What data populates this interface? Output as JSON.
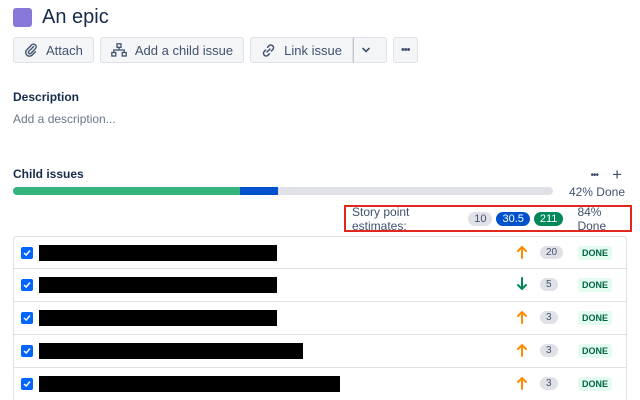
{
  "issue": {
    "title": "An epic",
    "type_color": "#8777d9"
  },
  "toolbar": {
    "attach_label": "Attach",
    "add_child_label": "Add a child issue",
    "link_label": "Link issue",
    "more_label": "•••"
  },
  "description": {
    "label": "Description",
    "placeholder": "Add a description..."
  },
  "child_issues": {
    "label": "Child issues",
    "more_label": "•••",
    "add_label": "+",
    "progress": {
      "done_fraction": 0.42,
      "in_progress_fraction": 0.07,
      "text": "42% Done"
    },
    "estimates": {
      "label": "Story point estimates:",
      "todo": "10",
      "in_progress": "30.5",
      "done": "211",
      "percent_text": "84% Done"
    },
    "rows": [
      {
        "priority": "up",
        "points": "20",
        "status": "DONE"
      },
      {
        "priority": "down",
        "points": "5",
        "status": "DONE"
      },
      {
        "priority": "up",
        "points": "3",
        "status": "DONE"
      },
      {
        "priority": "up",
        "points": "3",
        "status": "DONE"
      },
      {
        "priority": "up",
        "points": "3",
        "status": "DONE"
      }
    ]
  },
  "colors": {
    "priority_up": "#ff8b00",
    "priority_down": "#00875a",
    "done_green": "#36b37e",
    "in_progress_blue": "#0052cc",
    "highlight_red": "#e0281f"
  }
}
